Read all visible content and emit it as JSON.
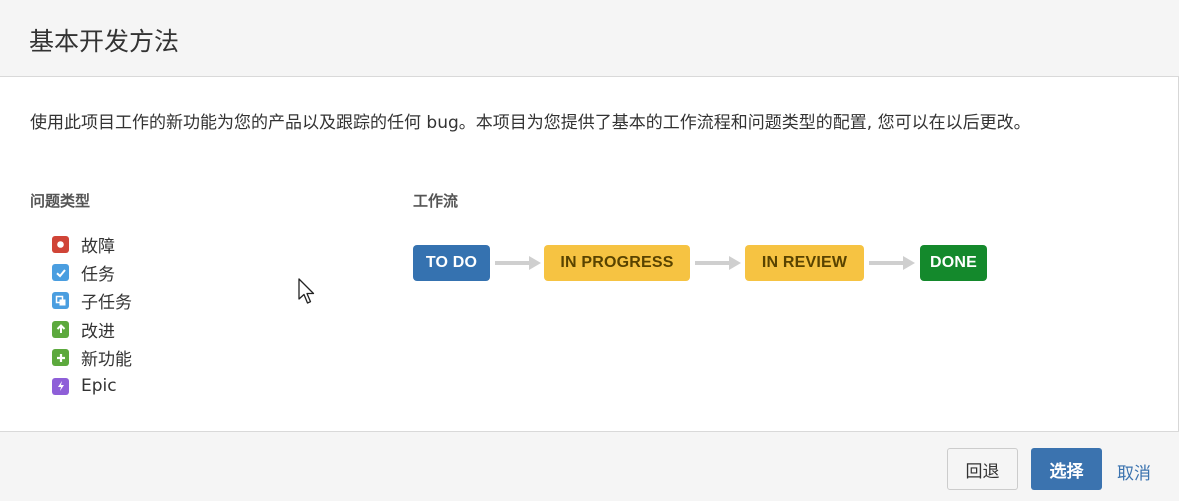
{
  "dialog": {
    "title": "基本开发方法",
    "description": "使用此项目工作的新功能为您的产品以及跟踪的任何 bug。本项目为您提供了基本的工作流程和问题类型的配置, 您可以在以后更改。"
  },
  "issue_types": {
    "label": "问题类型",
    "items": [
      {
        "label": "故障",
        "icon": "bug-icon",
        "color": "#d04437"
      },
      {
        "label": "任务",
        "icon": "task-check-icon",
        "color": "#4a9ee0"
      },
      {
        "label": "子任务",
        "icon": "subtask-icon",
        "color": "#4a9ee0"
      },
      {
        "label": "改进",
        "icon": "improvement-arrow-up-icon",
        "color": "#5ca93d"
      },
      {
        "label": "新功能",
        "icon": "new-feature-plus-icon",
        "color": "#5ca93d"
      },
      {
        "label": "Epic",
        "icon": "epic-lightning-icon",
        "color": "#8e5fd8"
      }
    ]
  },
  "workflow": {
    "label": "工作流",
    "statuses": [
      {
        "label": "TO DO",
        "bg": "#3572b0",
        "fg": "#ffffff"
      },
      {
        "label": "IN PROGRESS",
        "bg": "#f6c342",
        "fg": "#594300"
      },
      {
        "label": "IN REVIEW",
        "bg": "#f6c342",
        "fg": "#594300"
      },
      {
        "label": "DONE",
        "bg": "#14892c",
        "fg": "#ffffff"
      }
    ]
  },
  "footer": {
    "back_label": "回退",
    "select_label": "选择",
    "cancel_label": "取消"
  }
}
